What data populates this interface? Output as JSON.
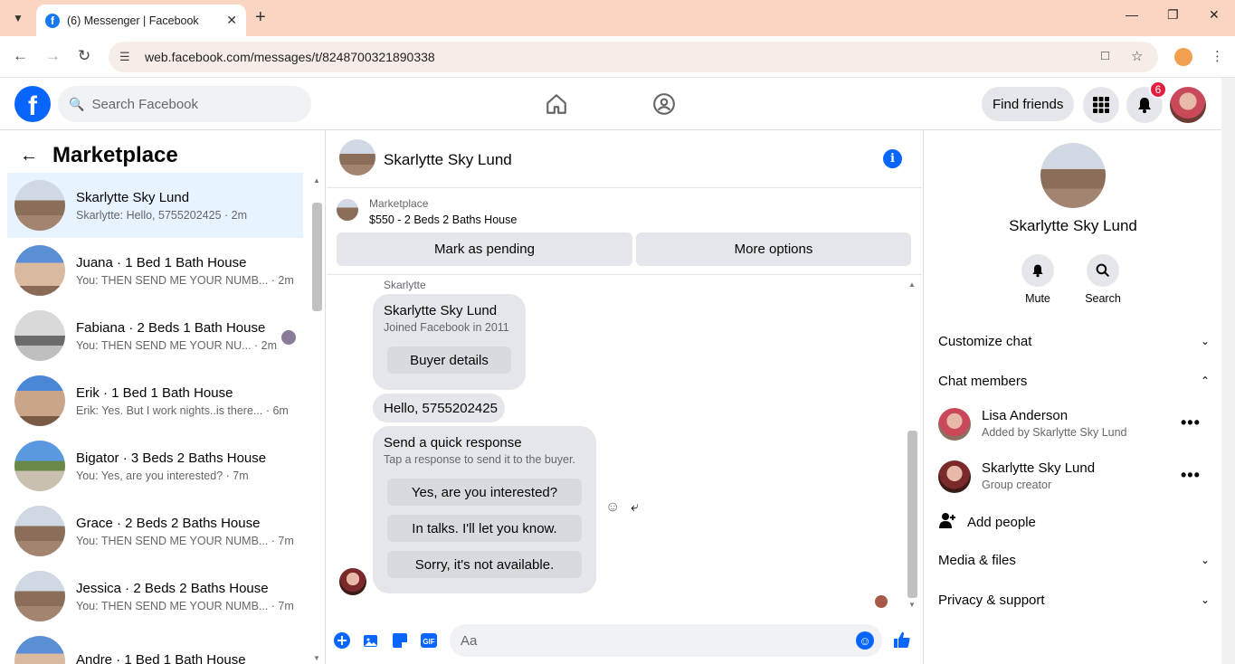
{
  "browser": {
    "tab_title": "(6) Messenger | Facebook",
    "url": "web.facebook.com/messages/t/8248700321890338"
  },
  "header": {
    "search_placeholder": "Search Facebook",
    "find_friends": "Find friends",
    "notification_count": "6"
  },
  "left": {
    "title": "Marketplace",
    "conversations": [
      {
        "name": "Skarlytte Sky Lund",
        "snippet": "Skarlytte: Hello, 5755202425 · 2m"
      },
      {
        "name": "Juana · 1 Bed 1 Bath House",
        "snippet": "You: THEN SEND ME YOUR NUMB... · 2m"
      },
      {
        "name": "Fabiana · 2 Beds 1 Bath House",
        "snippet": "You: THEN SEND ME YOUR NU... · 2m"
      },
      {
        "name": "Erik · 1 Bed 1 Bath House",
        "snippet": "Erik: Yes. But I work nights..is there... · 6m"
      },
      {
        "name": "Bigator · 3 Beds 2 Baths House",
        "snippet": "You: Yes, are you interested? · 7m"
      },
      {
        "name": "Grace · 2 Beds 2 Baths House",
        "snippet": "You: THEN SEND ME YOUR NUMB... · 7m"
      },
      {
        "name": "Jessica · 2 Beds 2 Baths House",
        "snippet": "You: THEN SEND ME YOUR NUMB... · 7m"
      },
      {
        "name": "Andre · 1 Bed 1 Bath House",
        "snippet": ""
      }
    ]
  },
  "chat": {
    "name": "Skarlytte Sky Lund",
    "marketplace_label": "Marketplace",
    "listing": "$550 - 2 Beds 2 Baths House",
    "mark_pending": "Mark as pending",
    "more_options": "More options",
    "sender_label": "Skarlytte",
    "card_name": "Skarlytte Sky Lund",
    "card_sub": "Joined Facebook in 2011",
    "buyer_details": "Buyer details",
    "message": "Hello, 5755202425",
    "quick_title": "Send a quick response",
    "quick_sub": "Tap a response to send it to the buyer.",
    "quick_1": "Yes, are you interested?",
    "quick_2": "In talks. I'll let you know.",
    "quick_3": "Sorry, it's not available.",
    "composer_placeholder": "Aa"
  },
  "right": {
    "name": "Skarlytte Sky Lund",
    "mute": "Mute",
    "search": "Search",
    "customize_chat": "Customize chat",
    "chat_members": "Chat members",
    "members": [
      {
        "name": "Lisa Anderson",
        "sub": "Added by Skarlytte Sky Lund"
      },
      {
        "name": "Skarlytte Sky Lund",
        "sub": "Group creator"
      }
    ],
    "add_people": "Add people",
    "media_files": "Media & files",
    "privacy_support": "Privacy & support"
  }
}
